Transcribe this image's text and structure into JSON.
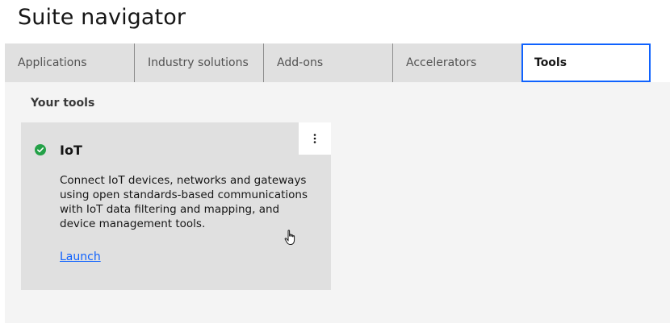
{
  "page": {
    "title": "Suite navigator"
  },
  "tabs": [
    {
      "label": "Applications",
      "selected": false
    },
    {
      "label": "Industry solutions",
      "selected": false
    },
    {
      "label": "Add-ons",
      "selected": false
    },
    {
      "label": "Accelerators",
      "selected": false
    },
    {
      "label": "Tools",
      "selected": true
    }
  ],
  "tools_section": {
    "title": "Your tools",
    "tile": {
      "name": "IoT",
      "status_icon": "check-circle-icon",
      "status_color": "#24a148",
      "description": "Connect IoT devices, networks and gateways using open standards-based communications with IoT data filtering and mapping, and device management tools.",
      "link_label": "Launch",
      "menu_icon": "overflow-menu-vertical-icon"
    }
  },
  "colors": {
    "accent": "#0f62fe",
    "tab_bg": "#e0e0e0",
    "panel_bg": "#f4f4f4",
    "success": "#24a148"
  }
}
